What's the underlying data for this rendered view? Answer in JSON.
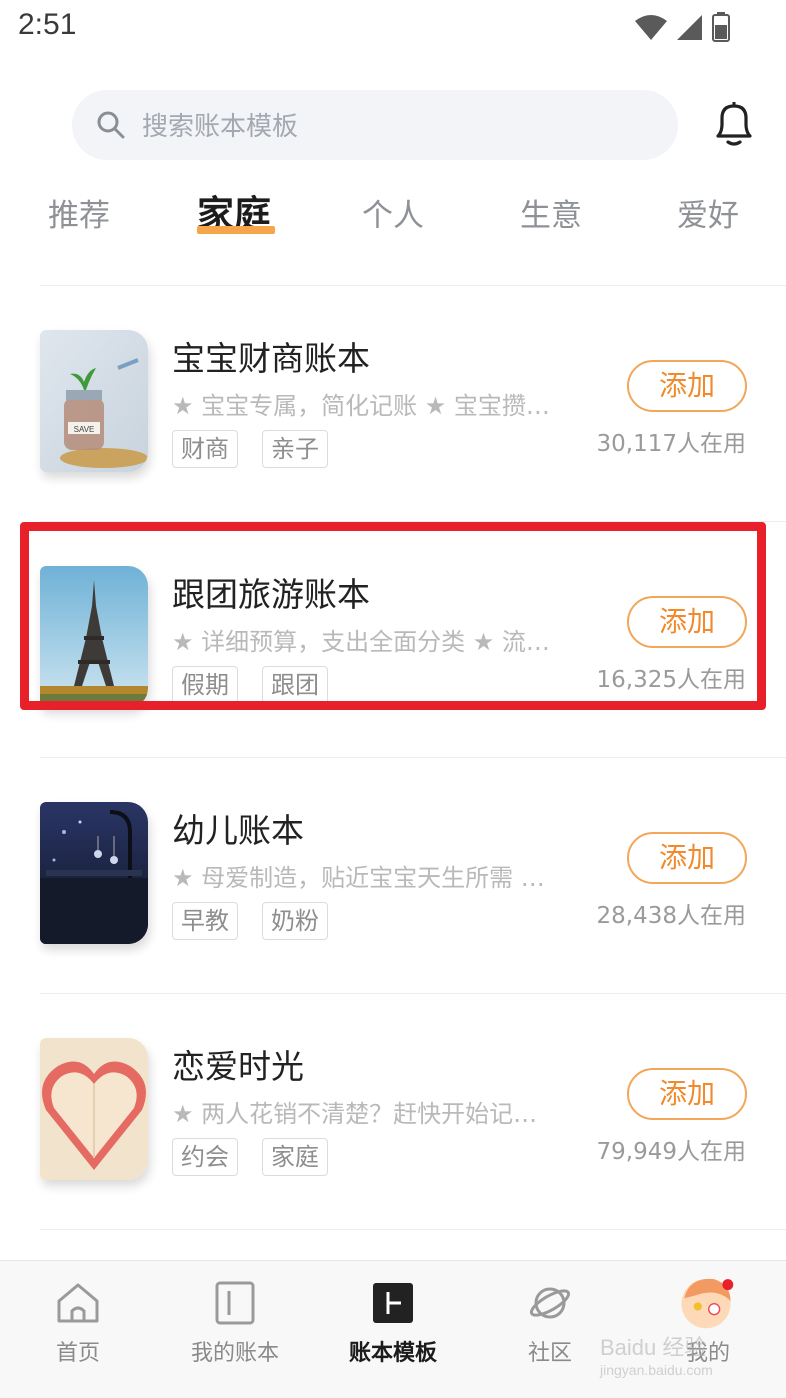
{
  "status_bar": {
    "time": "2:51"
  },
  "search": {
    "placeholder": "搜索账本模板"
  },
  "tabs": [
    {
      "label": "推荐"
    },
    {
      "label": "家庭"
    },
    {
      "label": "个人"
    },
    {
      "label": "生意"
    },
    {
      "label": "爱好"
    }
  ],
  "active_tab": "家庭",
  "templates": [
    {
      "title": "宝宝财商账本",
      "desc": "★ 宝宝专属，简化记账 ★ 宝宝攒…",
      "tags": [
        "财商",
        "亲子"
      ],
      "add_label": "添加",
      "users": "30,117人在用",
      "thumb_icon": "savings-jar-image"
    },
    {
      "title": "跟团旅游账本",
      "desc": "★ 详细预算，支出全面分类 ★ 流…",
      "tags": [
        "假期",
        "跟团"
      ],
      "add_label": "添加",
      "users": "16,325人在用",
      "thumb_icon": "eiffel-tower-image"
    },
    {
      "title": "幼儿账本",
      "desc": "★ 母爱制造，贴近宝宝天生所需 …",
      "tags": [
        "早教",
        "奶粉"
      ],
      "add_label": "添加",
      "users": "28,438人在用",
      "thumb_icon": "baby-crib-image"
    },
    {
      "title": "恋爱时光",
      "desc": "★ 两人花销不清楚？赶快开始记…",
      "tags": [
        "约会",
        "家庭"
      ],
      "add_label": "添加",
      "users": "79,949人在用",
      "thumb_icon": "paper-heart-image"
    }
  ],
  "bottom_nav": [
    {
      "label": "首页",
      "icon": "home-icon"
    },
    {
      "label": "我的账本",
      "icon": "book-icon"
    },
    {
      "label": "账本模板",
      "icon": "template-icon"
    },
    {
      "label": "社区",
      "icon": "planet-icon"
    },
    {
      "label": "我的",
      "icon": "avatar-icon"
    }
  ],
  "active_nav": "账本模板",
  "watermark": {
    "line1": "Baidu 经验",
    "line2": "jingyan.baidu.com"
  },
  "colors": {
    "accent": "#f08a2c",
    "highlight": "#e8202a",
    "underline": "#f5a64b"
  }
}
